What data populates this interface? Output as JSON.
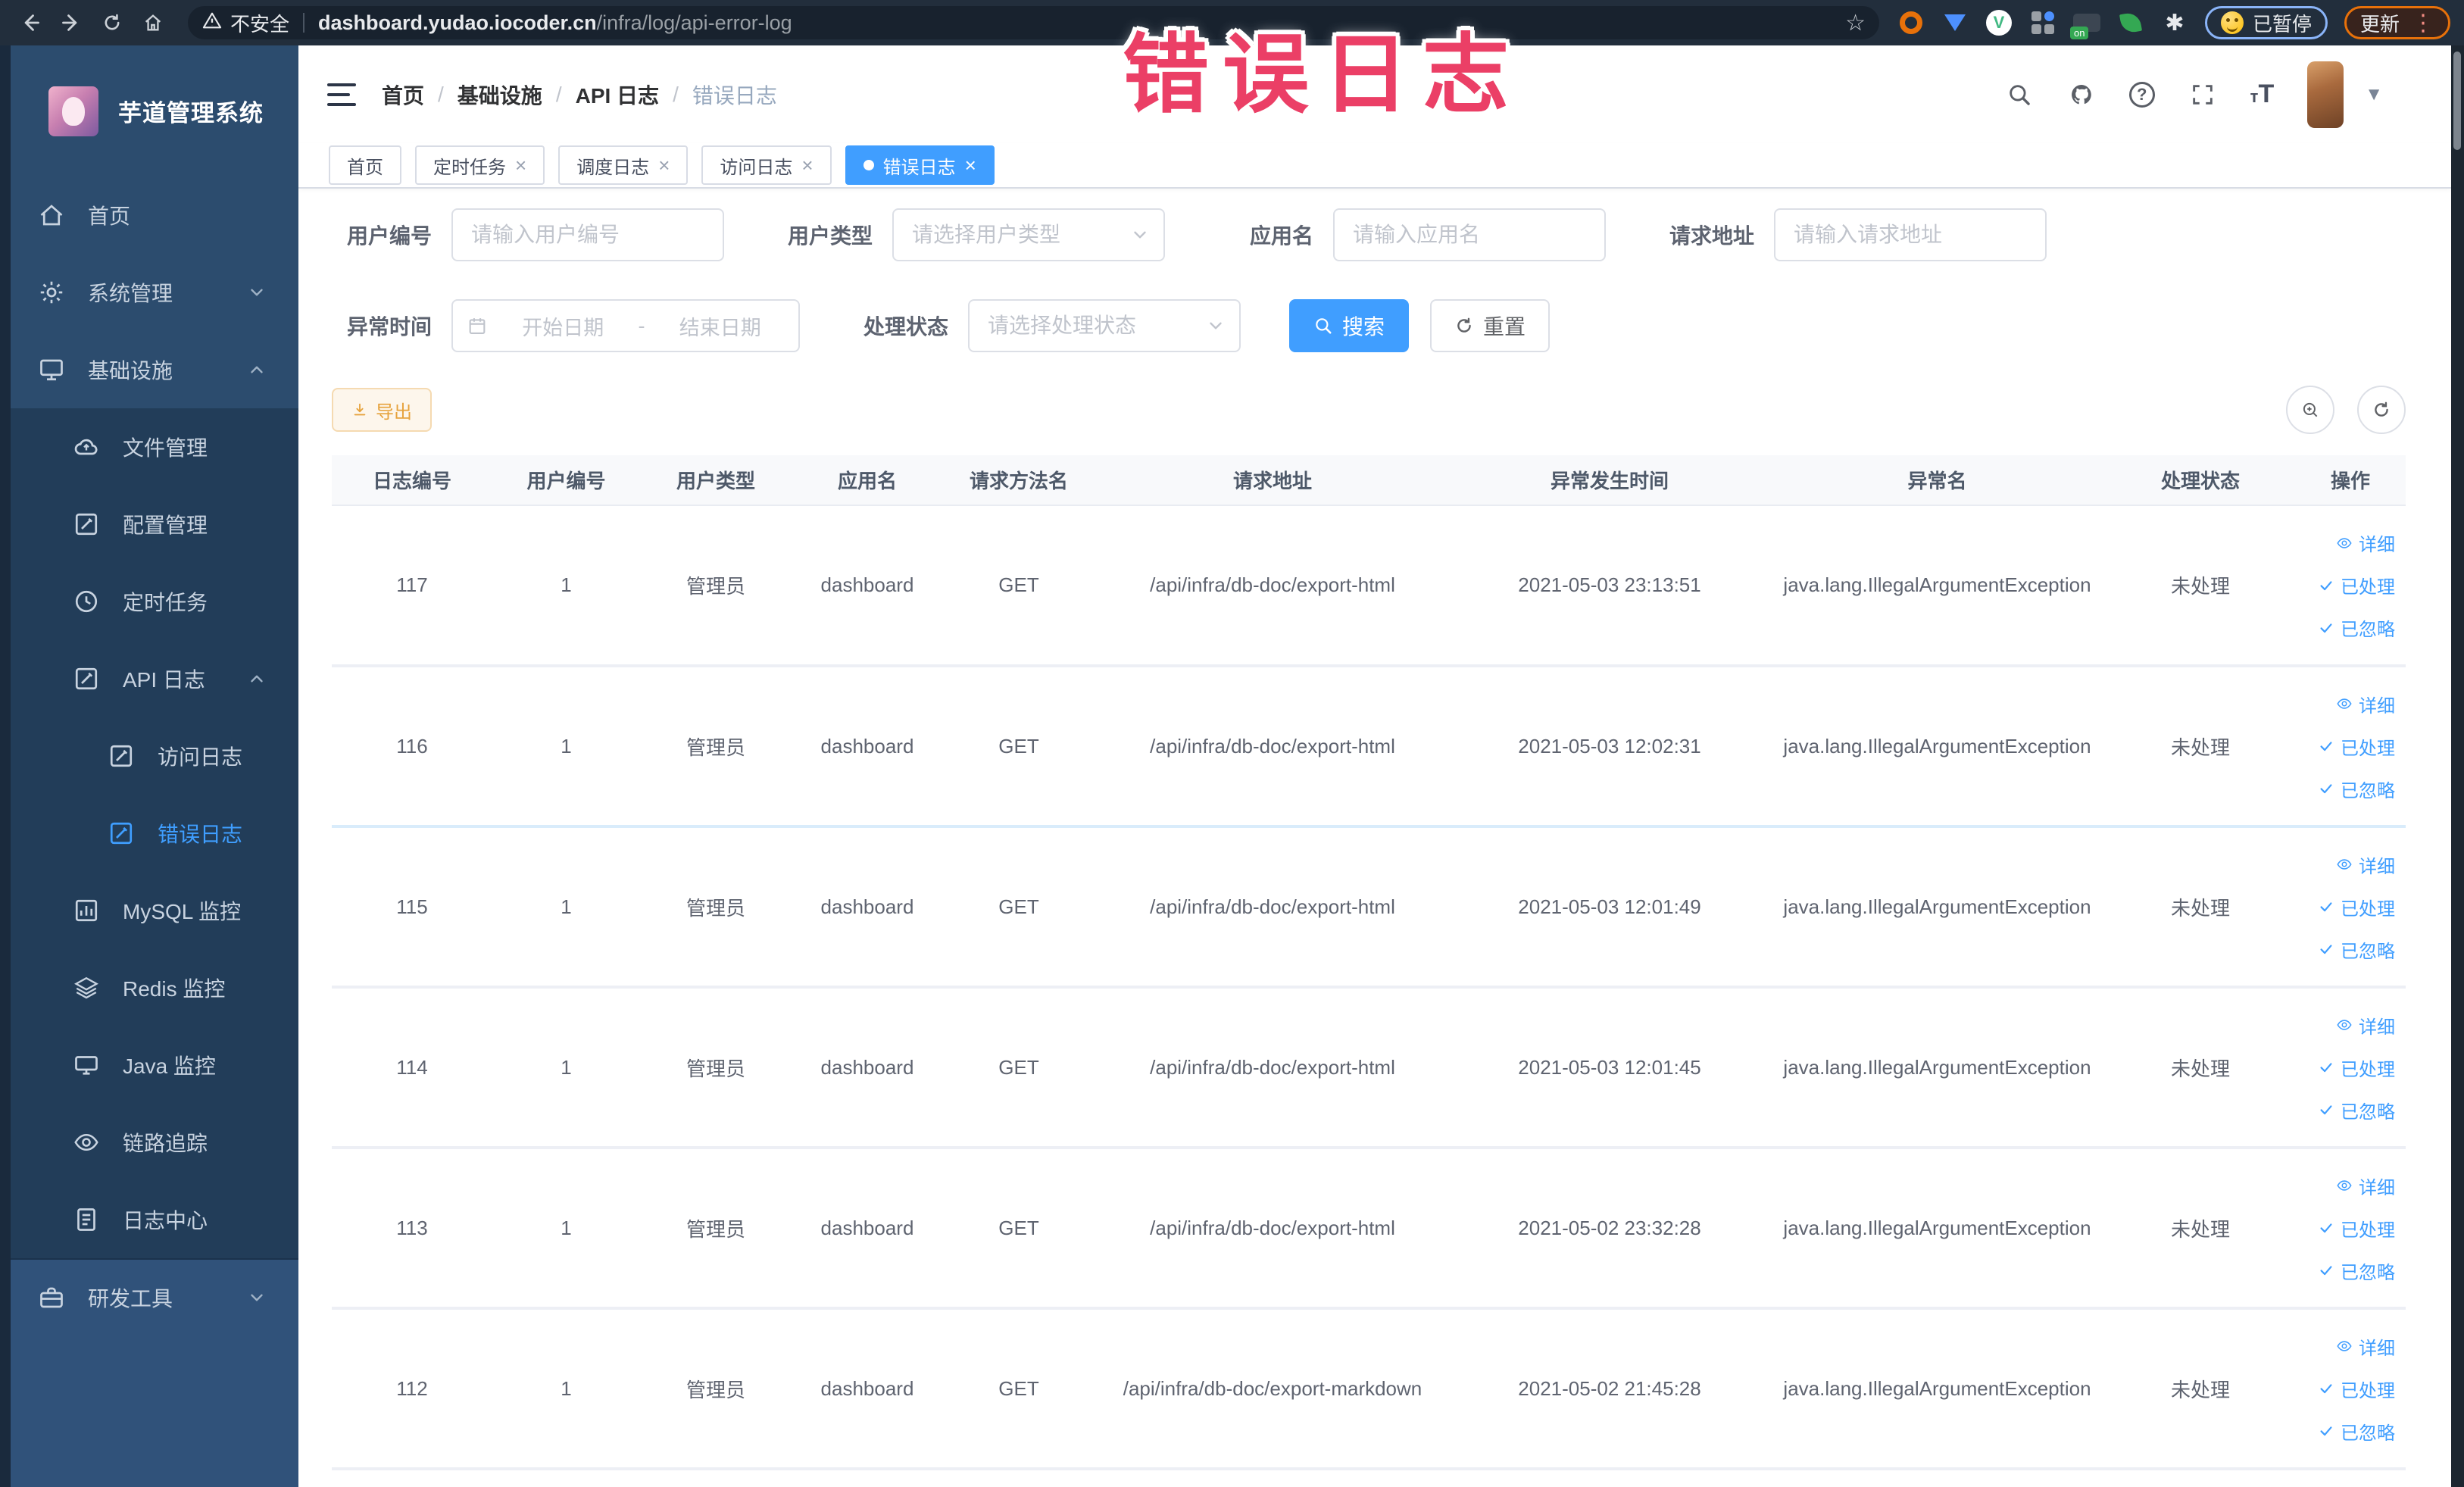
{
  "browser": {
    "security_label": "不安全",
    "url_domain": "dashboard.yudao.iocoder.cn",
    "url_path": "/infra/log/api-error-log",
    "paused_label": "已暂停",
    "update_label": "更新"
  },
  "overlay_title": "错误日志",
  "sidebar": {
    "logo_title": "芋道管理系统",
    "menu": [
      {
        "label": "首页",
        "icon": "home",
        "level": 0,
        "bg": "base",
        "chevron": ""
      },
      {
        "label": "系统管理",
        "icon": "gear",
        "level": 0,
        "bg": "base",
        "chevron": "down"
      },
      {
        "label": "基础设施",
        "icon": "monitor",
        "level": 0,
        "bg": "base",
        "chevron": "up"
      },
      {
        "label": "文件管理",
        "icon": "cloud",
        "level": 1,
        "bg": "sub",
        "chevron": ""
      },
      {
        "label": "配置管理",
        "icon": "edit",
        "level": 1,
        "bg": "sub",
        "chevron": ""
      },
      {
        "label": "定时任务",
        "icon": "clock",
        "level": 1,
        "bg": "sub",
        "chevron": ""
      },
      {
        "label": "API 日志",
        "icon": "edit",
        "level": 1,
        "bg": "sub",
        "chevron": "up"
      },
      {
        "label": "访问日志",
        "icon": "edit",
        "level": 2,
        "bg": "sub",
        "chevron": ""
      },
      {
        "label": "错误日志",
        "icon": "edit",
        "level": 2,
        "bg": "sub",
        "chevron": "",
        "active": true
      },
      {
        "label": "MySQL 监控",
        "icon": "chart",
        "level": 1,
        "bg": "sub",
        "chevron": ""
      },
      {
        "label": "Redis 监控",
        "icon": "layers",
        "level": 1,
        "bg": "sub",
        "chevron": ""
      },
      {
        "label": "Java 监控",
        "icon": "screen",
        "level": 1,
        "bg": "sub",
        "chevron": ""
      },
      {
        "label": "链路追踪",
        "icon": "eye",
        "level": 1,
        "bg": "sub",
        "chevron": ""
      },
      {
        "label": "日志中心",
        "icon": "doc",
        "level": 1,
        "bg": "sub",
        "chevron": ""
      },
      {
        "label": "研发工具",
        "icon": "toolbox",
        "level": 0,
        "bg": "dev",
        "chevron": "down"
      }
    ]
  },
  "breadcrumb": [
    "首页",
    "基础设施",
    "API 日志",
    "错误日志"
  ],
  "tabs": [
    {
      "label": "首页",
      "closable": false,
      "active": false
    },
    {
      "label": "定时任务",
      "closable": true,
      "active": false
    },
    {
      "label": "调度日志",
      "closable": true,
      "active": false
    },
    {
      "label": "访问日志",
      "closable": true,
      "active": false
    },
    {
      "label": "错误日志",
      "closable": true,
      "active": true
    }
  ],
  "filters": {
    "row1": [
      {
        "label": "用户编号",
        "placeholder": "请输入用户编号",
        "type": "input"
      },
      {
        "label": "用户类型",
        "placeholder": "请选择用户类型",
        "type": "select"
      },
      {
        "label": "应用名",
        "placeholder": "请输入应用名",
        "type": "input"
      },
      {
        "label": "请求地址",
        "placeholder": "请输入请求地址",
        "type": "input"
      }
    ],
    "row2_label": "异常时间",
    "date_start": "开始日期",
    "date_sep": "-",
    "date_end": "结束日期",
    "row2_select": {
      "label": "处理状态",
      "placeholder": "请选择处理状态"
    },
    "search_label": "搜索",
    "reset_label": "重置"
  },
  "toolbar": {
    "export_label": "导出"
  },
  "table": {
    "columns": [
      "日志编号",
      "用户编号",
      "用户类型",
      "应用名",
      "请求方法名",
      "请求地址",
      "异常发生时间",
      "异常名",
      "处理状态",
      "操作"
    ],
    "rows": [
      {
        "id": "117",
        "user_id": "1",
        "user_type": "管理员",
        "app": "dashboard",
        "method": "GET",
        "url": "/api/infra/db-doc/export-html",
        "time": "2021-05-03 23:13:51",
        "exception": "java.lang.IllegalArgumentException",
        "status": "未处理"
      },
      {
        "id": "116",
        "user_id": "1",
        "user_type": "管理员",
        "app": "dashboard",
        "method": "GET",
        "url": "/api/infra/db-doc/export-html",
        "time": "2021-05-03 12:02:31",
        "exception": "java.lang.IllegalArgumentException",
        "status": "未处理"
      },
      {
        "id": "115",
        "user_id": "1",
        "user_type": "管理员",
        "app": "dashboard",
        "method": "GET",
        "url": "/api/infra/db-doc/export-html",
        "time": "2021-05-03 12:01:49",
        "exception": "java.lang.IllegalArgumentException",
        "status": "未处理"
      },
      {
        "id": "114",
        "user_id": "1",
        "user_type": "管理员",
        "app": "dashboard",
        "method": "GET",
        "url": "/api/infra/db-doc/export-html",
        "time": "2021-05-03 12:01:45",
        "exception": "java.lang.IllegalArgumentException",
        "status": "未处理"
      },
      {
        "id": "113",
        "user_id": "1",
        "user_type": "管理员",
        "app": "dashboard",
        "method": "GET",
        "url": "/api/infra/db-doc/export-html",
        "time": "2021-05-02 23:32:28",
        "exception": "java.lang.IllegalArgumentException",
        "status": "未处理"
      },
      {
        "id": "112",
        "user_id": "1",
        "user_type": "管理员",
        "app": "dashboard",
        "method": "GET",
        "url": "/api/infra/db-doc/export-markdown",
        "time": "2021-05-02 21:45:28",
        "exception": "java.lang.IllegalArgumentException",
        "status": "未处理"
      }
    ],
    "actions": [
      "详细",
      "已处理",
      "已忽略"
    ]
  }
}
